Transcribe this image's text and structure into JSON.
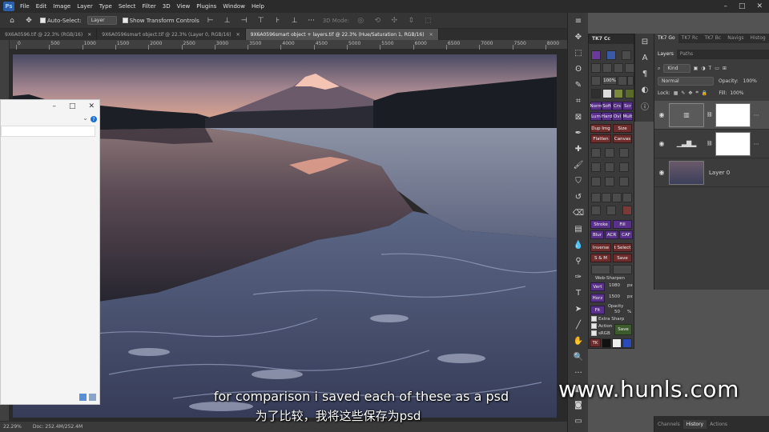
{
  "menu": [
    "File",
    "Edit",
    "Image",
    "Layer",
    "Type",
    "Select",
    "Filter",
    "3D",
    "View",
    "Plugins",
    "Window",
    "Help"
  ],
  "options_bar": {
    "auto_select_label": "Auto-Select:",
    "auto_select_value": "Layer",
    "show_transform_label": "Show Transform Controls",
    "mode_3d_label": "3D Mode:"
  },
  "tabs": [
    {
      "label": "9X6A0596.tif @ 22.3% (RGB/16)",
      "active": false
    },
    {
      "label": "9X6A0596smart object.tif @ 22.3% (Layer 0, RGB/16)",
      "active": false
    },
    {
      "label": "9X6A0596smart object + layers.tif @ 22.3% (Hue/Saturation 1, RGB/16)",
      "active": true
    }
  ],
  "ruler_ticks": [
    "0",
    "500",
    "1000",
    "1500",
    "2000",
    "2500",
    "3000",
    "3500",
    "4000",
    "4500",
    "5000",
    "5500",
    "6000",
    "6500",
    "7000",
    "7500",
    "8000"
  ],
  "status": {
    "zoom": "22.29%",
    "doc_size": "Doc: 252.4M/252.4M"
  },
  "tk7": {
    "title": "TK7 Cc",
    "row_norm": [
      "Norm",
      "Soft",
      "Crs",
      "Scr"
    ],
    "row_lum": [
      "Lum",
      "Hard",
      "Ovl",
      "Mult"
    ],
    "dup_img": "Dup Img",
    "size": "Size",
    "flatten": "Flatten",
    "canvas": "Canvas",
    "stroke": "Stroke",
    "fill": "Fill",
    "blur": "Blur",
    "acr": "ACR",
    "caf": "CAF",
    "inverse": "Inverse",
    "t_select": "t Select",
    "s_m": "S & M",
    "save": "Save",
    "web_sharpen": "Web-Sharpen",
    "vert_label": "Vert",
    "vert_value": "1080",
    "horz_label": "Horz",
    "horz_value": "1500",
    "unit": "px",
    "opacity_label": "Opacity",
    "opacity_value": "50",
    "percent": "%",
    "fit_label": "Fit",
    "extra_sharp": "Extra Sharp",
    "action": "Action",
    "srgb": "sRGB",
    "save_btn": "Save",
    "tk_label": "TK",
    "zoom_pct": "100%"
  },
  "layers_panel": {
    "top_tabs": [
      "TK7 Go",
      "TK7 Rc",
      "TK7 Bc",
      "Navigs",
      "Histog"
    ],
    "sub_tabs": [
      "Layers",
      "Paths"
    ],
    "kind": "Kind",
    "blend": "Normal",
    "opacity_label": "Opacity:",
    "opacity": "100%",
    "lock_label": "Lock:",
    "fill_label": "Fill:",
    "fill": "100%",
    "layers": [
      {
        "name": "",
        "type": "hue-saturation"
      },
      {
        "name": "",
        "type": "levels"
      },
      {
        "name": "Layer 0",
        "type": "image"
      }
    ]
  },
  "bottom_tabs": [
    "Channels",
    "History",
    "Actions"
  ],
  "subtitles": {
    "en": "for comparison i saved each of these as a psd",
    "zh": "为了比较，我将这些保存为psd"
  },
  "watermark": "www.hunls.com",
  "colors": {
    "accent_purple": "#59308a",
    "panel_bg": "#3a3a3a",
    "menu_bg": "#2b2b2b"
  }
}
